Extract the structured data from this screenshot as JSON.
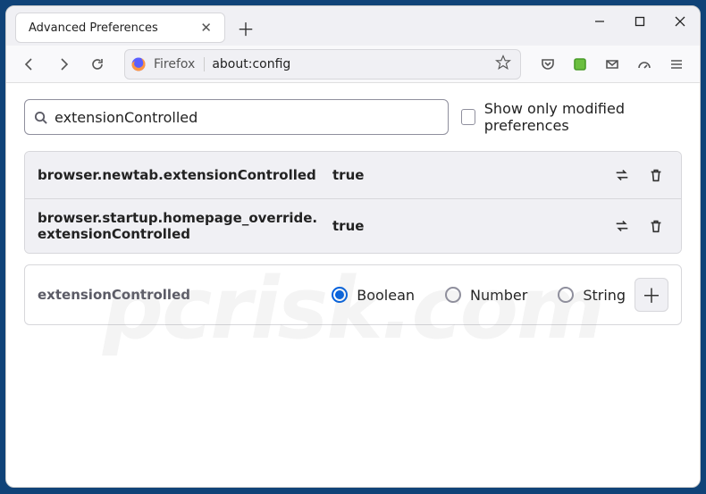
{
  "tab": {
    "title": "Advanced Preferences"
  },
  "url": {
    "identity": "Firefox",
    "address": "about:config"
  },
  "search": {
    "value": "extensionControlled",
    "checkbox_label": "Show only modified preferences"
  },
  "prefs": [
    {
      "name": "browser.newtab.extensionControlled",
      "value": "true"
    },
    {
      "name": "browser.startup.homepage_override.extensionControlled",
      "value": "true"
    }
  ],
  "add": {
    "name": "extensionControlled",
    "options": [
      "Boolean",
      "Number",
      "String"
    ],
    "selected_index": 0
  },
  "watermark": "pcrisk.com"
}
